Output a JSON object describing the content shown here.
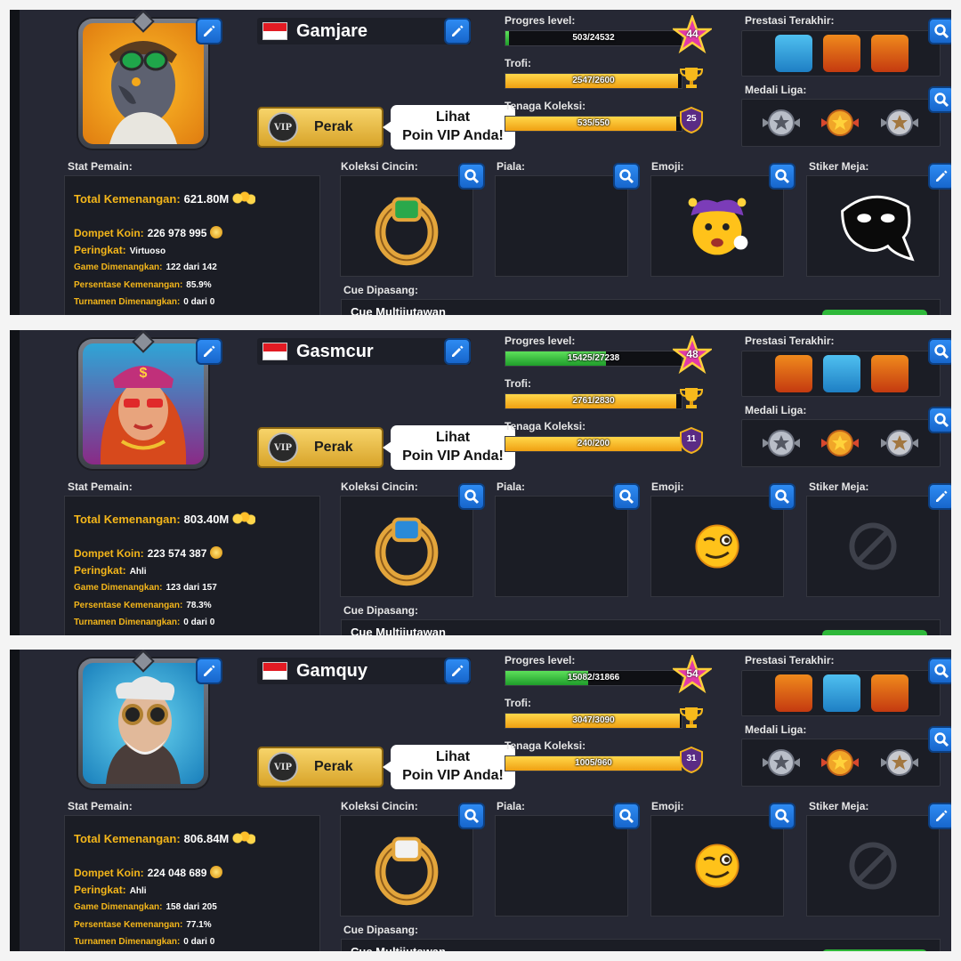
{
  "labels": {
    "progres_level": "Progres level:",
    "trofi": "Trofi:",
    "tenaga_koleksi": "Tenaga Koleksi:",
    "prestasi_terakhir": "Prestasi Terakhir:",
    "medali_liga": "Medali Liga:",
    "stat_pemain": "Stat Pemain:",
    "koleksi_cincin": "Koleksi Cincin:",
    "piala": "Piala:",
    "emoji": "Emoji:",
    "stiker_meja": "Stiker Meja:",
    "cue_dipasang": "Cue Dipasang:",
    "vip_label": "Perak",
    "vip_badge": "VIP",
    "vip_bubble_line1": "Lihat",
    "vip_bubble_line2": "Poin VIP Anda!",
    "total_kemenangan": "Total Kemenangan:",
    "dompet_koin": "Dompet Koin:",
    "peringkat": "Peringkat:",
    "game_dimenangkan": "Game Dimenangkan:",
    "persentase_kemenangan": "Persentase Kemenangan:",
    "turnamen_dimenangkan": "Turnamen Dimenangkan:"
  },
  "profiles": [
    {
      "name": "Gamjare",
      "level": "44",
      "level_progress_text": "503/24532",
      "level_progress": 0.02,
      "trophy_text": "2547/2600",
      "trophy_progress": 0.98,
      "collection_text": "535/550",
      "collection_progress": 0.97,
      "collection_badge": "25",
      "total_winnings": "621.80M",
      "coins": "226 978 995",
      "rank": "Virtuoso",
      "games_won": "122 dari 142",
      "win_pct": "85.9%",
      "tournaments": "0 dari 0",
      "cue_name": "Cue Multijutawan",
      "avatar": "pigeon-pilot-avatar",
      "emoji": "jester-emoji",
      "sticker": "mask-sticker"
    },
    {
      "name": "Gasmcur",
      "level": "48",
      "level_progress_text": "15425/27238",
      "level_progress": 0.57,
      "trophy_text": "2761/2830",
      "trophy_progress": 0.97,
      "collection_text": "240/200",
      "collection_progress": 1.0,
      "collection_badge": "11",
      "total_winnings": "803.40M",
      "coins": "223 574 387",
      "rank": "Ahli",
      "games_won": "123 dari 157",
      "win_pct": "78.3%",
      "tournaments": "0 dari 0",
      "cue_name": "Cue Multijutawan",
      "avatar": "woman-cap-avatar",
      "emoji": "wink-emoji",
      "sticker": "no-sticker"
    },
    {
      "name": "Gamquy",
      "level": "54",
      "level_progress_text": "15082/31866",
      "level_progress": 0.47,
      "trophy_text": "3047/3090",
      "trophy_progress": 0.99,
      "collection_text": "1005/960",
      "collection_progress": 1.0,
      "collection_badge": "31",
      "total_winnings": "806.84M",
      "coins": "224 048 689",
      "rank": "Ahli",
      "games_won": "158 dari 205",
      "win_pct": "77.1%",
      "tournaments": "0 dari 0",
      "cue_name": "Cue Multijutawan",
      "avatar": "old-man-goggles-avatar",
      "emoji": "wink-emoji",
      "sticker": "no-sticker"
    }
  ],
  "colors": {
    "panel_bg": "#262834",
    "accent_blue": "#1f7be0",
    "gold": "#f4b61a",
    "green": "#3ccf3d"
  }
}
